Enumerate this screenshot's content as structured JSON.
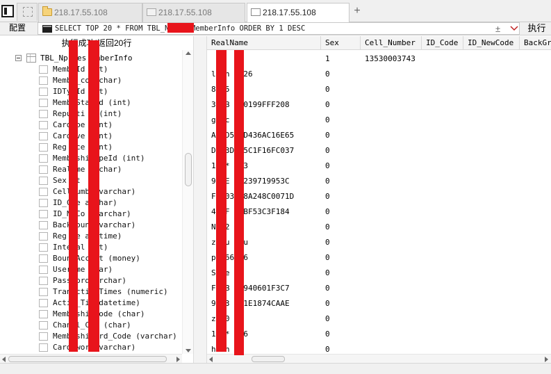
{
  "tabs": [
    {
      "label": "218.17.55.108",
      "icon": "folder-icon",
      "active": false
    },
    {
      "label": "218.17.55.108",
      "icon": "document-icon",
      "active": false
    },
    {
      "label": "218.17.55.108",
      "icon": "document-icon",
      "active": true
    }
  ],
  "new_tab_label": "+",
  "toolbar": {
    "config_label": "配置",
    "sql": "SELECT TOP 20 * FROM TBL_Np          es_MemberInfo ORDER BY 1 DESC",
    "sql_mark": "±",
    "run_label": "执行"
  },
  "status": "执行成功!返回20行",
  "tree": {
    "root_label": "TBL_Np      les    emberInfo",
    "columns": [
      "Memb   Id   int)",
      "Memb   _co    (char)",
      "IDTy   Id   int)",
      "Memb   Sta  Id (int)",
      "Repu    ti   d (int)",
      "Card    pe   (int)",
      "Card    ve   (int)",
      "Reg    rce     (int)",
      "Memb    shi    ypeId (int)",
      "Real    me    archar)",
      "Sex    nt",
      "Cell    umb      (varchar)",
      "ID_C    e    archar)",
      "ID_N    Co     (varchar)",
      "Back    oun   (varchar)",
      "Reg    me    atetime)",
      "Inte    al     int)",
      "Boun    Acc    nt (money)",
      "User    me   char)",
      "Pass    ord   archar)",
      "Tran    cti    _Times (numeric)",
      "Acti    _Ti     (datetime)",
      "Memb    shi    Code (char)",
      "Chan    l_C    e (char)",
      "Memb    shi    ard_Code (varchar)",
      "Card    wor     (varchar)"
    ]
  },
  "grid": {
    "headers": [
      "RealName",
      "Sex",
      "Cell_Number",
      "ID_Code",
      "ID_NewCode",
      "BackGro"
    ],
    "rows": [
      {
        "real_name": "",
        "sex": "1",
        "cell": "13530003743"
      },
      {
        "real_name": "l       an  6526",
        "sex": "0",
        "cell": ""
      },
      {
        "real_name": "8       55    7",
        "sex": "0",
        "cell": ""
      },
      {
        "real_name": "3       XB    CE0199FFF208",
        "sex": "0",
        "cell": ""
      },
      {
        "real_name": "g       rc    1",
        "sex": "0",
        "cell": ""
      },
      {
        "real_name": "A       2D5   5D436AC16E65",
        "sex": "0",
        "cell": ""
      },
      {
        "real_name": "D       53D   95C1F16FC037",
        "sex": "0",
        "cell": ""
      },
      {
        "real_name": "1       **    193",
        "sex": "0",
        "cell": ""
      },
      {
        "real_name": "9       AE    FA239719953C",
        "sex": "0",
        "cell": ""
      },
      {
        "real_name": "F       A03   88A248C0071D",
        "sex": "0",
        "cell": ""
      },
      {
        "real_name": "4       7F    4ABF53C3F184",
        "sex": "0",
        "cell": ""
      },
      {
        "real_name": "N       22    2",
        "sex": "0",
        "cell": ""
      },
      {
        "real_name": "z       au    nyu",
        "sex": "0",
        "cell": ""
      },
      {
        "real_name": "p       966   66",
        "sex": "0",
        "cell": ""
      },
      {
        "real_name": "S       ze",
        "sex": "0",
        "cell": ""
      },
      {
        "real_name": "F       XB    53940601F3C7",
        "sex": "0",
        "cell": ""
      },
      {
        "real_name": "9       D3    A31E1874CAAE",
        "sex": "0",
        "cell": ""
      },
      {
        "real_name": "z       20",
        "sex": "0",
        "cell": ""
      },
      {
        "real_name": "1       **    696",
        "sex": "0",
        "cell": ""
      },
      {
        "real_name": "h       ln",
        "sex": "0",
        "cell": ""
      }
    ]
  },
  "colors": {
    "redaction": "#e8141b",
    "chrome": "#f0f0f0",
    "border": "#c8c8c8"
  }
}
